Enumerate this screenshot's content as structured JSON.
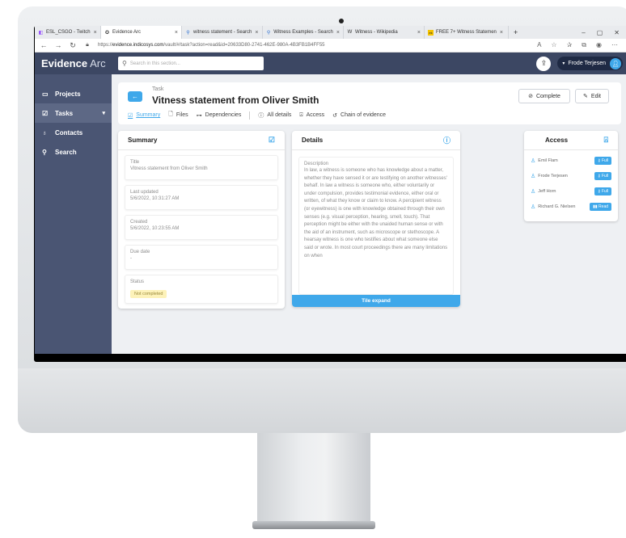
{
  "browser": {
    "tabs": [
      {
        "title": "ESL_CSGO - Twitch",
        "icon": "twitch-icon"
      },
      {
        "title": "Evidence Arc",
        "icon": "evidence-arc-icon",
        "active": true
      },
      {
        "title": "witness statement - Search",
        "icon": "search-icon"
      },
      {
        "title": "Witness Examples - Search",
        "icon": "search-icon"
      },
      {
        "title": "Witness - Wikipedia",
        "icon": "wikipedia-icon"
      },
      {
        "title": "FREE 7+ Witness Statemen",
        "icon": "ek-icon"
      }
    ],
    "close_glyph": "×",
    "new_tab_glyph": "+",
    "url_prefix": "https://",
    "url_host": "evidence.indicosys.com",
    "url_path": "/vault/#/task?action=read&id=20633D80-2741-462E-980A-4B3FB1B4FF55"
  },
  "app": {
    "brand": "Evidence",
    "brand_suffix": "Arc",
    "search_placeholder": "Search in this section...",
    "user_name": "Frode Terjesen",
    "sidebar": [
      {
        "label": "Projects",
        "icon": "projects-icon"
      },
      {
        "label": "Tasks",
        "icon": "tasks-icon",
        "active": true
      },
      {
        "label": "Contacts",
        "icon": "contacts-icon"
      },
      {
        "label": "Search",
        "icon": "search-icon"
      }
    ]
  },
  "task": {
    "label": "Task",
    "title": "Vitness statement from Oliver Smith",
    "complete_label": "Complete",
    "edit_label": "Edit",
    "tabs": [
      {
        "label": "Summary",
        "selected": true
      },
      {
        "label": "Files"
      },
      {
        "label": "Dependencies"
      },
      {
        "label": "All details"
      },
      {
        "label": "Access"
      },
      {
        "label": "Chain of evidence"
      }
    ]
  },
  "summary": {
    "heading": "Summary",
    "fields": [
      {
        "label": "Title",
        "value": "Vitness statement from Oliver Smith"
      },
      {
        "label": "Last updated",
        "value": "5/6/2022, 10:31:27 AM"
      },
      {
        "label": "Created",
        "value": "5/6/2022, 10:23:55 AM"
      },
      {
        "label": "Due date",
        "value": "-"
      }
    ],
    "status_label": "Status",
    "status_value": "Not completed"
  },
  "details": {
    "heading": "Details",
    "desc_label": "Description",
    "desc_text": "In law, a witness is someone who has knowledge about a matter, whether they have sensed it or are testifying on another witnesses' behalf. In law a witness is someone who, either voluntarily or under compulsion, provides testimonial evidence, either oral or written, of what they know or claim to know. A percipient witness (or eyewitness) is one with knowledge obtained through their own senses (e.g. visual perception, hearing, smell, touch). That perception might be either with the unaided human sense or with the aid of an instrument, such as microscope or stethoscope. A hearsay witness is one who testifies about what someone else said or wrote. In most court proceedings there are many limitations on when",
    "expand_label": "Tile expand"
  },
  "access": {
    "heading": "Access",
    "entries": [
      {
        "name": "Emil Flam",
        "permission": "Full"
      },
      {
        "name": "Frode Terjesen",
        "permission": "Full"
      },
      {
        "name": "Jeff Horn",
        "permission": "Full"
      },
      {
        "name": "Richard G. Nielsen",
        "permission": "Read"
      }
    ]
  },
  "colors": {
    "accent": "#3fa8ea",
    "sidebar": "#4a5573",
    "topbar": "#3c4763",
    "status_badge_bg": "#fdf2b9"
  }
}
